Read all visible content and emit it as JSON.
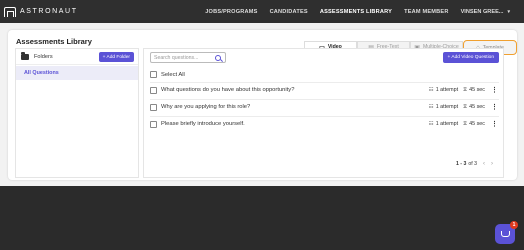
{
  "app": {
    "brand": "ASTRONAUT"
  },
  "nav": {
    "items": [
      {
        "label": "JOBS/PROGRAMS"
      },
      {
        "label": "CANDIDATES"
      },
      {
        "label": "ASSESSMENTS LIBRARY"
      },
      {
        "label": "TEAM MEMBER"
      }
    ],
    "user": "VINSEN GREE...",
    "user_icon": "chevron-down-icon"
  },
  "library": {
    "title": "Assessments Library",
    "tabs": [
      {
        "label": "Video",
        "icon": "video-icon"
      },
      {
        "label": "Free-Text",
        "icon": "text-icon"
      },
      {
        "label": "Multiple-Choice",
        "icon": "list-icon"
      },
      {
        "label": "Template",
        "icon": "briefcase-icon"
      }
    ],
    "active_tab": "Video"
  },
  "folders": {
    "label": "Folders",
    "add_button": "+ Add Folder",
    "items": [
      {
        "label": "All Questions"
      }
    ]
  },
  "questions": {
    "search_placeholder": "Search questions...",
    "add_button": "+ Add Video Question",
    "select_all": "Select All",
    "rows": [
      {
        "text": "What questions do you have about this opportunity?",
        "attempts": "1 attempt",
        "duration": "45 sec"
      },
      {
        "text": "Why are you applying for this role?",
        "attempts": "1 attempt",
        "duration": "45 sec"
      },
      {
        "text": "Please briefly introduce yourself.",
        "attempts": "1 attempt",
        "duration": "45 sec"
      }
    ],
    "pagination": {
      "range": "1 - 3",
      "of": "of 3"
    }
  },
  "chat": {
    "badge": "1"
  },
  "colors": {
    "accent": "#5b52d6",
    "highlight": "#f0a030",
    "nav_bg": "#2f2f2f",
    "badge": "#e03a1e"
  }
}
